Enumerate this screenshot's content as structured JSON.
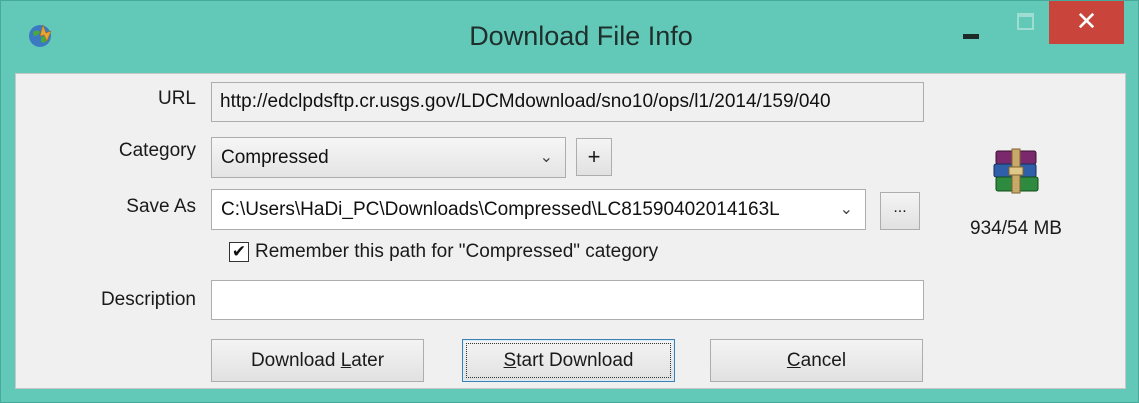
{
  "window": {
    "title": "Download File Info",
    "close_glyph": "✕"
  },
  "form": {
    "url_label": "URL",
    "url_value": "http://edclpdsftp.cr.usgs.gov/LDCMdownload/sno10/ops/l1/2014/159/040",
    "category_label": "Category",
    "category_value": "Compressed",
    "add_category": "+",
    "saveas_label": "Save As",
    "saveas_value": "C:\\Users\\HaDi_PC\\Downloads\\Compressed\\LC81590402014163L",
    "browse_label": "...",
    "remember_checked": true,
    "remember_label": "Remember this path for \"Compressed\" category",
    "description_label": "Description",
    "description_value": ""
  },
  "buttons": {
    "later_pre": "Download ",
    "later_u": "L",
    "later_post": "ater",
    "start_u": "S",
    "start_post": "tart Download",
    "cancel_u": "C",
    "cancel_post": "ancel"
  },
  "file": {
    "icon": "winrar-archive-icon",
    "size": "934/54  MB"
  },
  "colors": {
    "titlebar": "#62c9b9",
    "close": "#c9453b"
  }
}
